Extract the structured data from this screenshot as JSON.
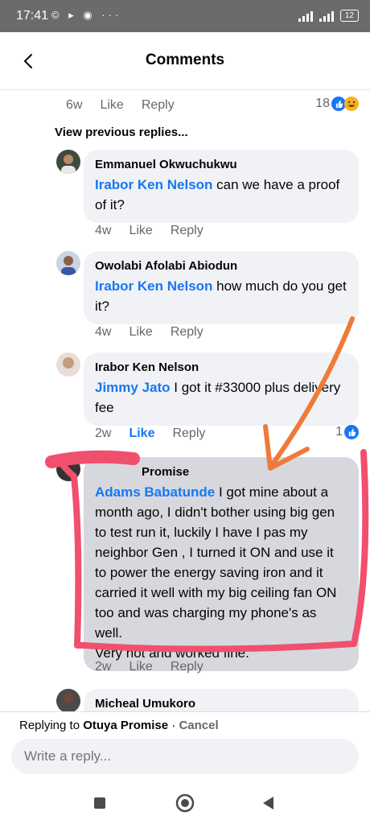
{
  "status": {
    "time": "17:41",
    "left_icons": "© ▸ ◉  ···",
    "battery": "12"
  },
  "header": {
    "title": "Comments",
    "back_icon": "back-arrow-icon"
  },
  "top_meta": {
    "time": "6w",
    "like": "Like",
    "reply": "Reply",
    "reaction_count": "18"
  },
  "view_previous": "View previous replies...",
  "comments": [
    {
      "name": "Emmanuel Okwuchukwu",
      "mention": "Irabor Ken Nelson",
      "text": " can we have a proof of it?",
      "time": "4w",
      "like": "Like",
      "reply": "Reply"
    },
    {
      "name": "Owolabi Afolabi Abiodun",
      "mention": "Irabor Ken Nelson",
      "text": " how much do you get it?",
      "time": "4w",
      "like": "Like",
      "reply": "Reply"
    },
    {
      "name": "Irabor Ken Nelson",
      "mention": "Jimmy Jato",
      "text": " I got it #33000 plus delivery fee",
      "time": "2w",
      "like": "Like",
      "reply": "Reply",
      "reaction_count": "1"
    },
    {
      "name": "Promise",
      "mention": "Adams Babatunde",
      "text": " I got mine about a month ago, I didn't bother using big gen to test run it, luckily I have I pas my neighbor Gen , I turned it ON and use it to power the energy saving iron and it carried it well with my big ceiling fan ON too and was charging my phone's as well.",
      "text2": "Very hot and worked fine.",
      "time": "2w",
      "like": "Like",
      "reply": "Reply"
    },
    {
      "name": "Micheal Umukoro"
    }
  ],
  "replying": {
    "prefix": "Replying to ",
    "name": "Otuya Promise",
    "sep": " · ",
    "cancel": "Cancel"
  },
  "reply_input": {
    "placeholder": "Write a reply..."
  },
  "colors": {
    "accent": "#1877f2",
    "annotation_red": "#f0506e",
    "annotation_orange": "#f07a3a"
  }
}
